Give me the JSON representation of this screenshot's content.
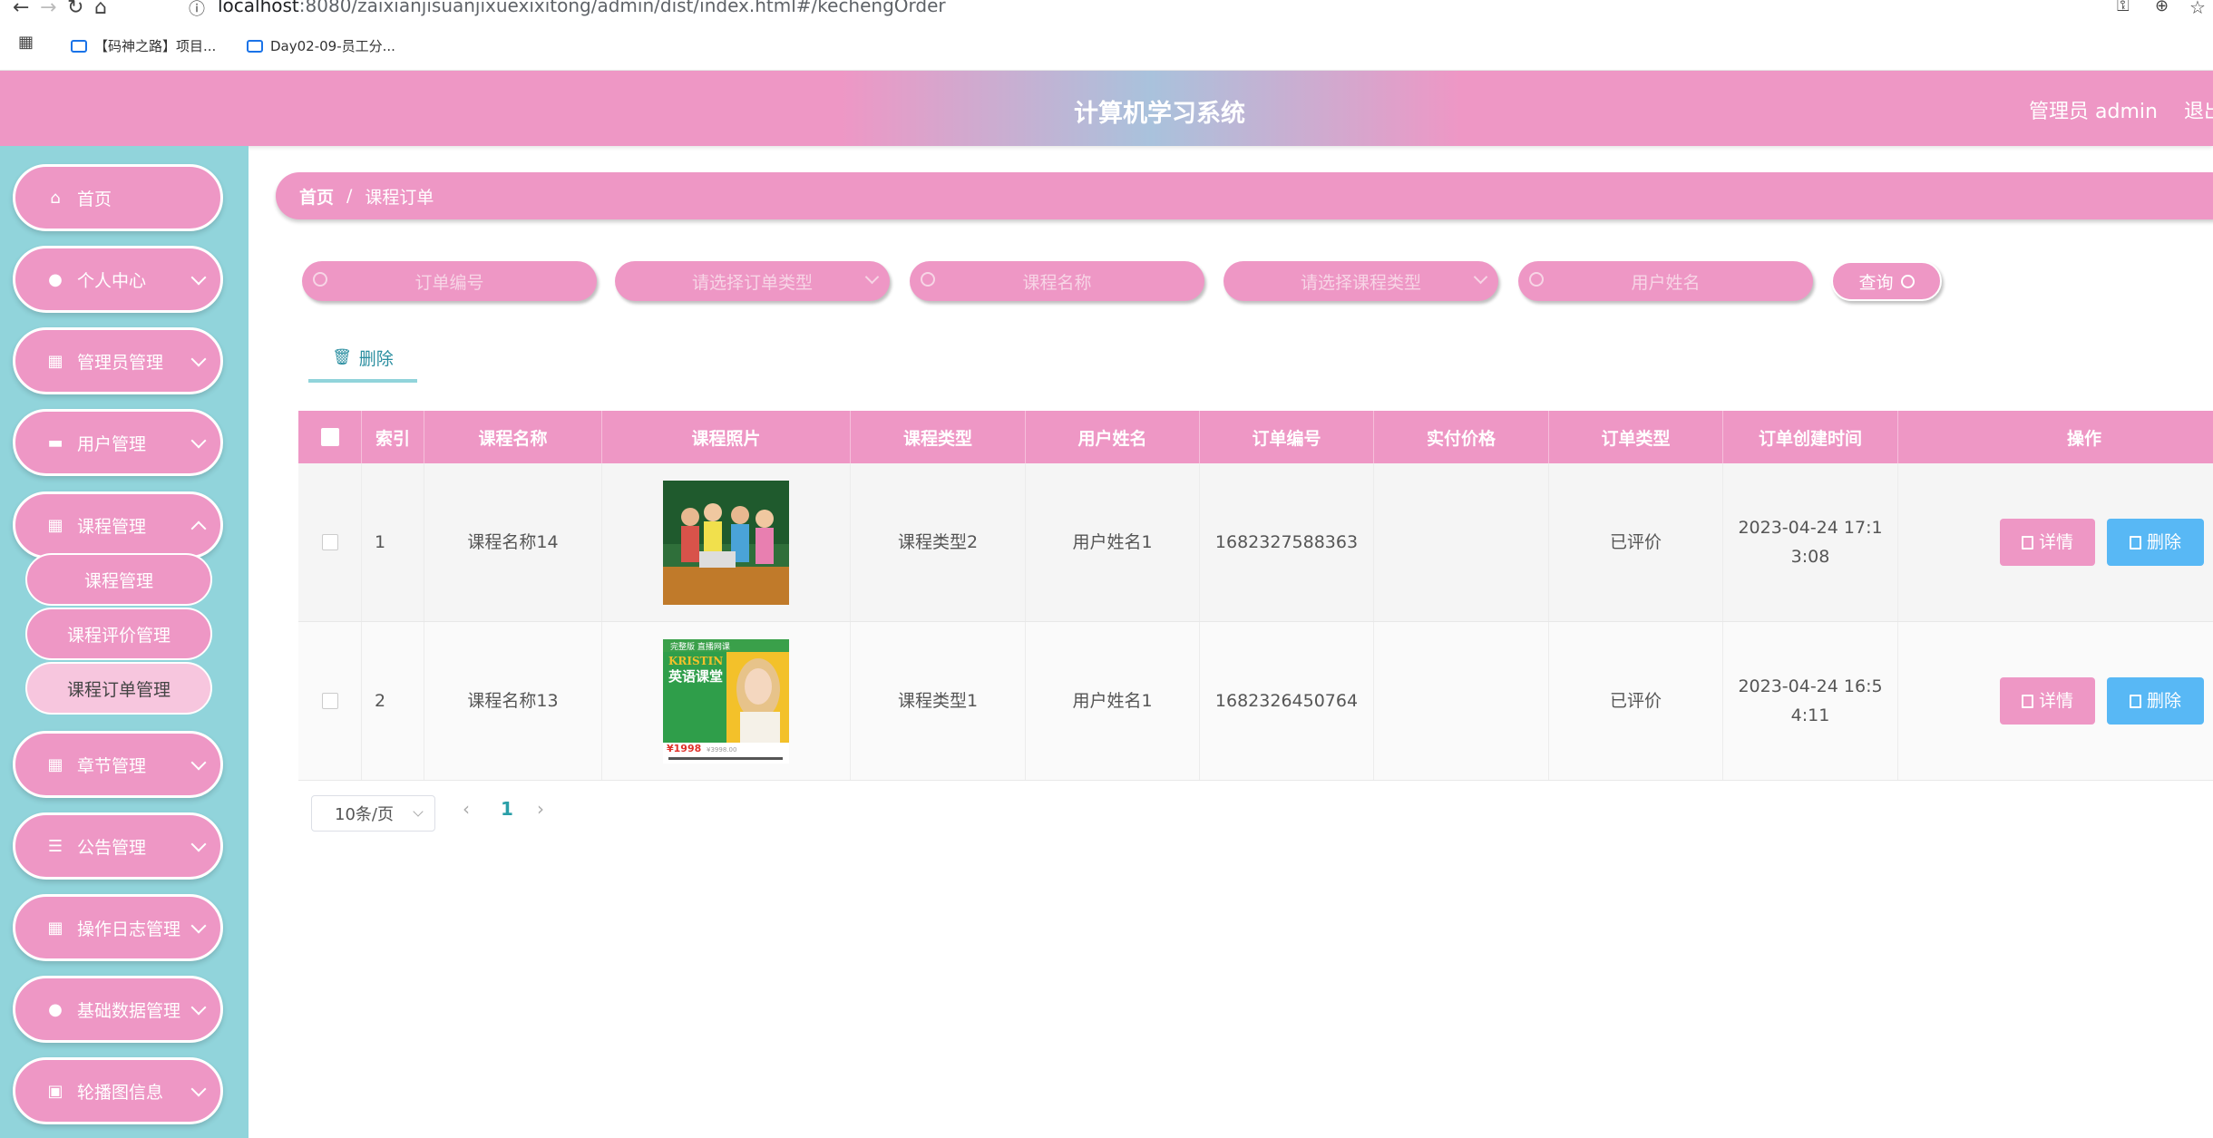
{
  "browser": {
    "url_host": "localhost",
    "url_path": ":8080/zaixianjisuanjixuexixitong/admin/dist/index.html#/kechengOrder",
    "bookmarks": [
      "【码神之路】项目...",
      "Day02-09-员工分..."
    ]
  },
  "header": {
    "title": "计算机学习系统",
    "admin": "管理员 admin",
    "logout": "退出登录"
  },
  "sidebar": {
    "items": [
      {
        "label": "首页",
        "icon": "home-icon"
      },
      {
        "label": "个人中心",
        "icon": "user-icon"
      },
      {
        "label": "管理员管理",
        "icon": "grid-icon"
      },
      {
        "label": "用户管理",
        "icon": "id-card-icon"
      },
      {
        "label": "课程管理",
        "icon": "grid-icon"
      },
      {
        "label": "章节管理",
        "icon": "grid-icon"
      },
      {
        "label": "公告管理",
        "icon": "list-icon"
      },
      {
        "label": "操作日志管理",
        "icon": "grid-icon"
      },
      {
        "label": "基础数据管理",
        "icon": "user-icon"
      },
      {
        "label": "轮播图信息",
        "icon": "clipboard-icon"
      }
    ],
    "subitems": [
      {
        "label": "课程管理"
      },
      {
        "label": "课程评价管理"
      },
      {
        "label": "课程订单管理"
      }
    ]
  },
  "breadcrumb": {
    "home": "首页",
    "sep": "/",
    "current": "课程订单"
  },
  "filters": {
    "order_no": "订单编号",
    "order_type": "请选择订单类型",
    "course_name": "课程名称",
    "course_type": "请选择课程类型",
    "user_name": "用户姓名",
    "query": "查询"
  },
  "toolbar": {
    "delete": "删除"
  },
  "table": {
    "headers": [
      "索引",
      "课程名称",
      "课程照片",
      "课程类型",
      "用户姓名",
      "订单编号",
      "实付价格",
      "订单类型",
      "订单创建时间",
      "操作"
    ],
    "rows": [
      {
        "index": "1",
        "name": "课程名称14",
        "type": "课程类型2",
        "user": "用户姓名1",
        "order_no": "1682327588363",
        "price": "",
        "order_type": "已评价",
        "time_a": "2023-04-24 17:1",
        "time_b": "3:08",
        "detail": "详情",
        "delete": "删除"
      },
      {
        "index": "2",
        "name": "课程名称13",
        "type": "课程类型1",
        "user": "用户姓名1",
        "order_no": "1682326450764",
        "price": "",
        "order_type": "已评价",
        "time_a": "2023-04-24 16:5",
        "time_b": "4:11",
        "detail": "详情",
        "delete": "删除"
      }
    ],
    "poster": {
      "brand": "KRISTIN",
      "title": "英语课堂",
      "price": "¥1998",
      "old": "¥3998.00",
      "tag": "完整版 直播网课"
    }
  },
  "pagination": {
    "page_size": "10条/页",
    "current": "1",
    "prev": "‹",
    "next": "›"
  }
}
